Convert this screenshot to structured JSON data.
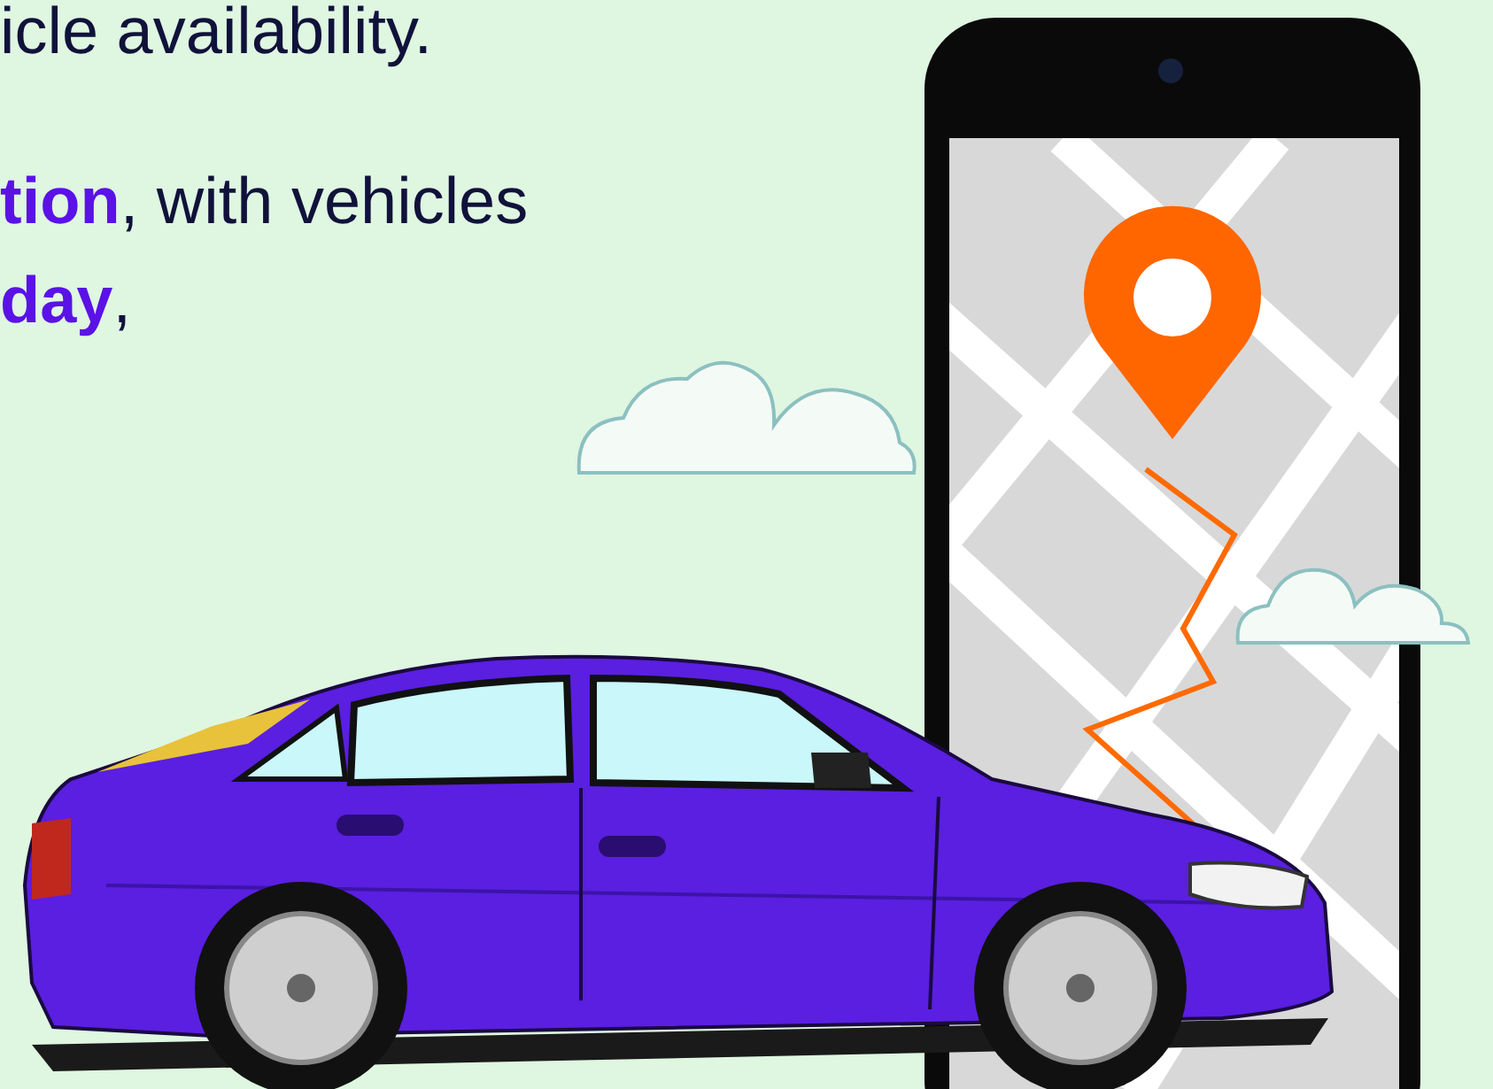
{
  "paragraphs": [
    {
      "lines": [
        "icle availability."
      ]
    },
    {
      "lines": [
        "**tion**, with vehicles",
        "**day**,"
      ]
    }
  ]
}
